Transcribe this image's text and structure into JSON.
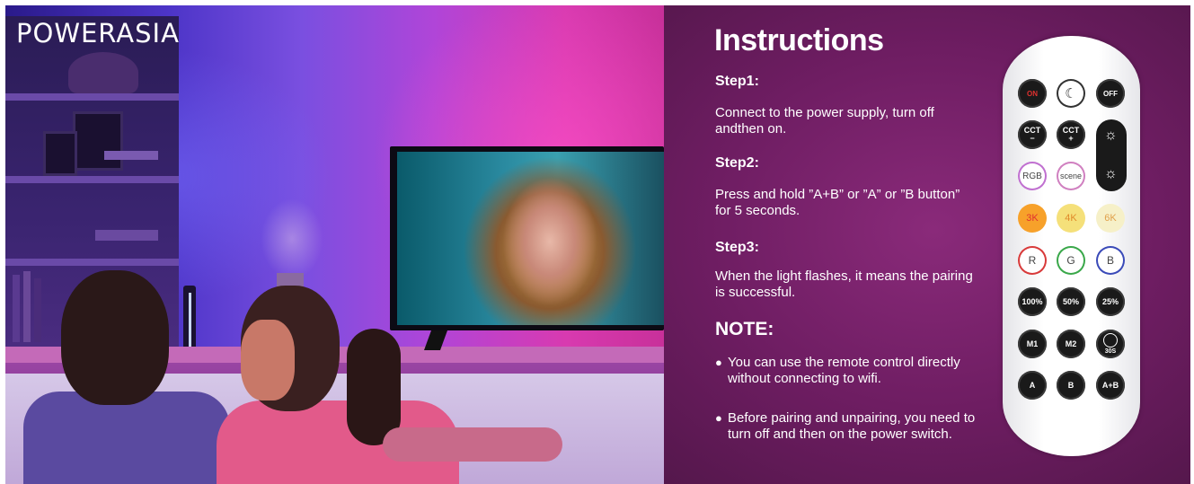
{
  "brand": {
    "name": "POWERASIA"
  },
  "instructions": {
    "title": "Instructions",
    "steps": [
      {
        "label": "Step1:",
        "text": "Connect to the power supply, turn off andthen on."
      },
      {
        "label": "Step2:",
        "text": "Press and hold ”A+B” or ”A” or ”B button” for 5 seconds."
      },
      {
        "label": "Step3:",
        "text": "When the light flashes, it means the pairing is successful."
      }
    ],
    "note_title": "NOTE:",
    "notes": [
      "You can use the remote control directly without connecting to wifi.",
      "Before pairing and unpairing, you need to turn off and then on the power switch."
    ]
  },
  "remote": {
    "on": "ON",
    "off": "OFF",
    "cct_minus": "CCT",
    "cct_plus": "CCT",
    "rgb": "RGB",
    "scene": "scene",
    "k3": "3K",
    "k4": "4K",
    "k6": "6K",
    "r": "R",
    "g": "G",
    "b": "B",
    "p100": "100%",
    "p50": "50%",
    "p25": "25%",
    "m1": "M1",
    "m2": "M2",
    "timer": "30S",
    "a": "A",
    "bb": "B",
    "ab": "A+B",
    "colors": {
      "on_red": "#e0312f",
      "k3": "#f7a12a",
      "k4": "#f5e07a",
      "k6": "#f6f0c8",
      "r": "#d83a3a",
      "g": "#3aa84a",
      "b": "#3a4ab8"
    }
  }
}
